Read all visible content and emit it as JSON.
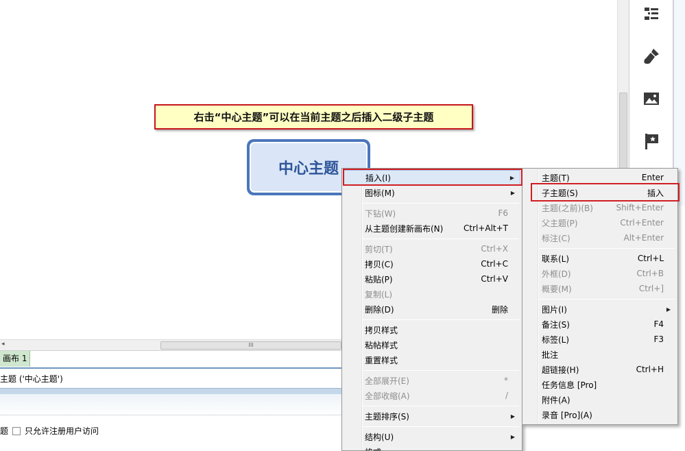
{
  "canvas": {
    "callout_text": "右击“中心主题”可以在当前主题之后插入二级子主题",
    "central_topic": "中心主题"
  },
  "right_panel": {
    "icons": [
      "outline-icon",
      "brush-icon",
      "image-icon",
      "flag-icon"
    ]
  },
  "hscroll": {
    "left_arrow": "◂",
    "thumb_grip": "III"
  },
  "tabbar": {
    "sheet_tab": "画布 1"
  },
  "status": {
    "text": "主题 ('中心主题')"
  },
  "bottom": {
    "left_text": "题",
    "checkbox_label": "只允许注册用户访问"
  },
  "context_menu": {
    "items": [
      {
        "label": "插入(I)",
        "shortcut": "",
        "submenu": true,
        "disabled": false
      },
      {
        "label": "图标(M)",
        "shortcut": "",
        "submenu": true,
        "disabled": false
      },
      {
        "label": "下钻(W)",
        "shortcut": "F6",
        "submenu": false,
        "disabled": true
      },
      {
        "label": "从主题创建新画布(N)",
        "shortcut": "Ctrl+Alt+T",
        "submenu": false,
        "disabled": false
      },
      {
        "label": "剪切(T)",
        "shortcut": "Ctrl+X",
        "submenu": false,
        "disabled": true
      },
      {
        "label": "拷贝(C)",
        "shortcut": "Ctrl+C",
        "submenu": false,
        "disabled": false
      },
      {
        "label": "粘贴(P)",
        "shortcut": "Ctrl+V",
        "submenu": false,
        "disabled": false
      },
      {
        "label": "复制(L)",
        "shortcut": "",
        "submenu": false,
        "disabled": true
      },
      {
        "label": "删除(D)",
        "shortcut": "删除",
        "submenu": false,
        "disabled": false
      },
      {
        "label": "拷贝样式",
        "shortcut": "",
        "submenu": false,
        "disabled": false
      },
      {
        "label": "粘帖样式",
        "shortcut": "",
        "submenu": false,
        "disabled": false
      },
      {
        "label": "重置样式",
        "shortcut": "",
        "submenu": false,
        "disabled": false
      },
      {
        "label": "全部展开(E)",
        "shortcut": "*",
        "submenu": false,
        "disabled": true
      },
      {
        "label": "全部收缩(A)",
        "shortcut": "/",
        "submenu": false,
        "disabled": true
      },
      {
        "label": "主题排序(S)",
        "shortcut": "",
        "submenu": true,
        "disabled": false
      },
      {
        "label": "结构(U)",
        "shortcut": "",
        "submenu": true,
        "disabled": false
      },
      {
        "label": "格式",
        "shortcut": "",
        "submenu": false,
        "disabled": false
      }
    ]
  },
  "submenu": {
    "items": [
      {
        "label": "主题(T)",
        "shortcut": "Enter",
        "submenu": false,
        "disabled": false
      },
      {
        "label": "子主题(S)",
        "shortcut": "插入",
        "submenu": false,
        "disabled": false
      },
      {
        "label": "主题(之前)(B)",
        "shortcut": "Shift+Enter",
        "submenu": false,
        "disabled": true
      },
      {
        "label": "父主题(P)",
        "shortcut": "Ctrl+Enter",
        "submenu": false,
        "disabled": true
      },
      {
        "label": "标注(C)",
        "shortcut": "Alt+Enter",
        "submenu": false,
        "disabled": true
      },
      {
        "label": "联系(L)",
        "shortcut": "Ctrl+L",
        "submenu": false,
        "disabled": false
      },
      {
        "label": "外框(D)",
        "shortcut": "Ctrl+B",
        "submenu": false,
        "disabled": true
      },
      {
        "label": "概要(M)",
        "shortcut": "Ctrl+]",
        "submenu": false,
        "disabled": true
      },
      {
        "label": "图片(I)",
        "shortcut": "",
        "submenu": true,
        "disabled": false
      },
      {
        "label": "备注(S)",
        "shortcut": "F4",
        "submenu": false,
        "disabled": false
      },
      {
        "label": "标签(L)",
        "shortcut": "F3",
        "submenu": false,
        "disabled": false
      },
      {
        "label": "批注",
        "shortcut": "",
        "submenu": false,
        "disabled": false
      },
      {
        "label": "超链接(H)",
        "shortcut": "Ctrl+H",
        "submenu": false,
        "disabled": false
      },
      {
        "label": "任务信息 [Pro]",
        "shortcut": "",
        "submenu": false,
        "disabled": false
      },
      {
        "label": "附件(A)",
        "shortcut": "",
        "submenu": false,
        "disabled": false
      },
      {
        "label": "录音 [Pro](A)",
        "shortcut": "",
        "submenu": false,
        "disabled": false
      }
    ]
  },
  "colors": {
    "callout_bg": "#ffffc4",
    "annotation_red": "#d01d22",
    "topic_border": "#4a76bb",
    "topic_fill": "#dae6f7",
    "menu_bg": "#f0f0f0",
    "menu_highlight": "#dce8f6"
  }
}
